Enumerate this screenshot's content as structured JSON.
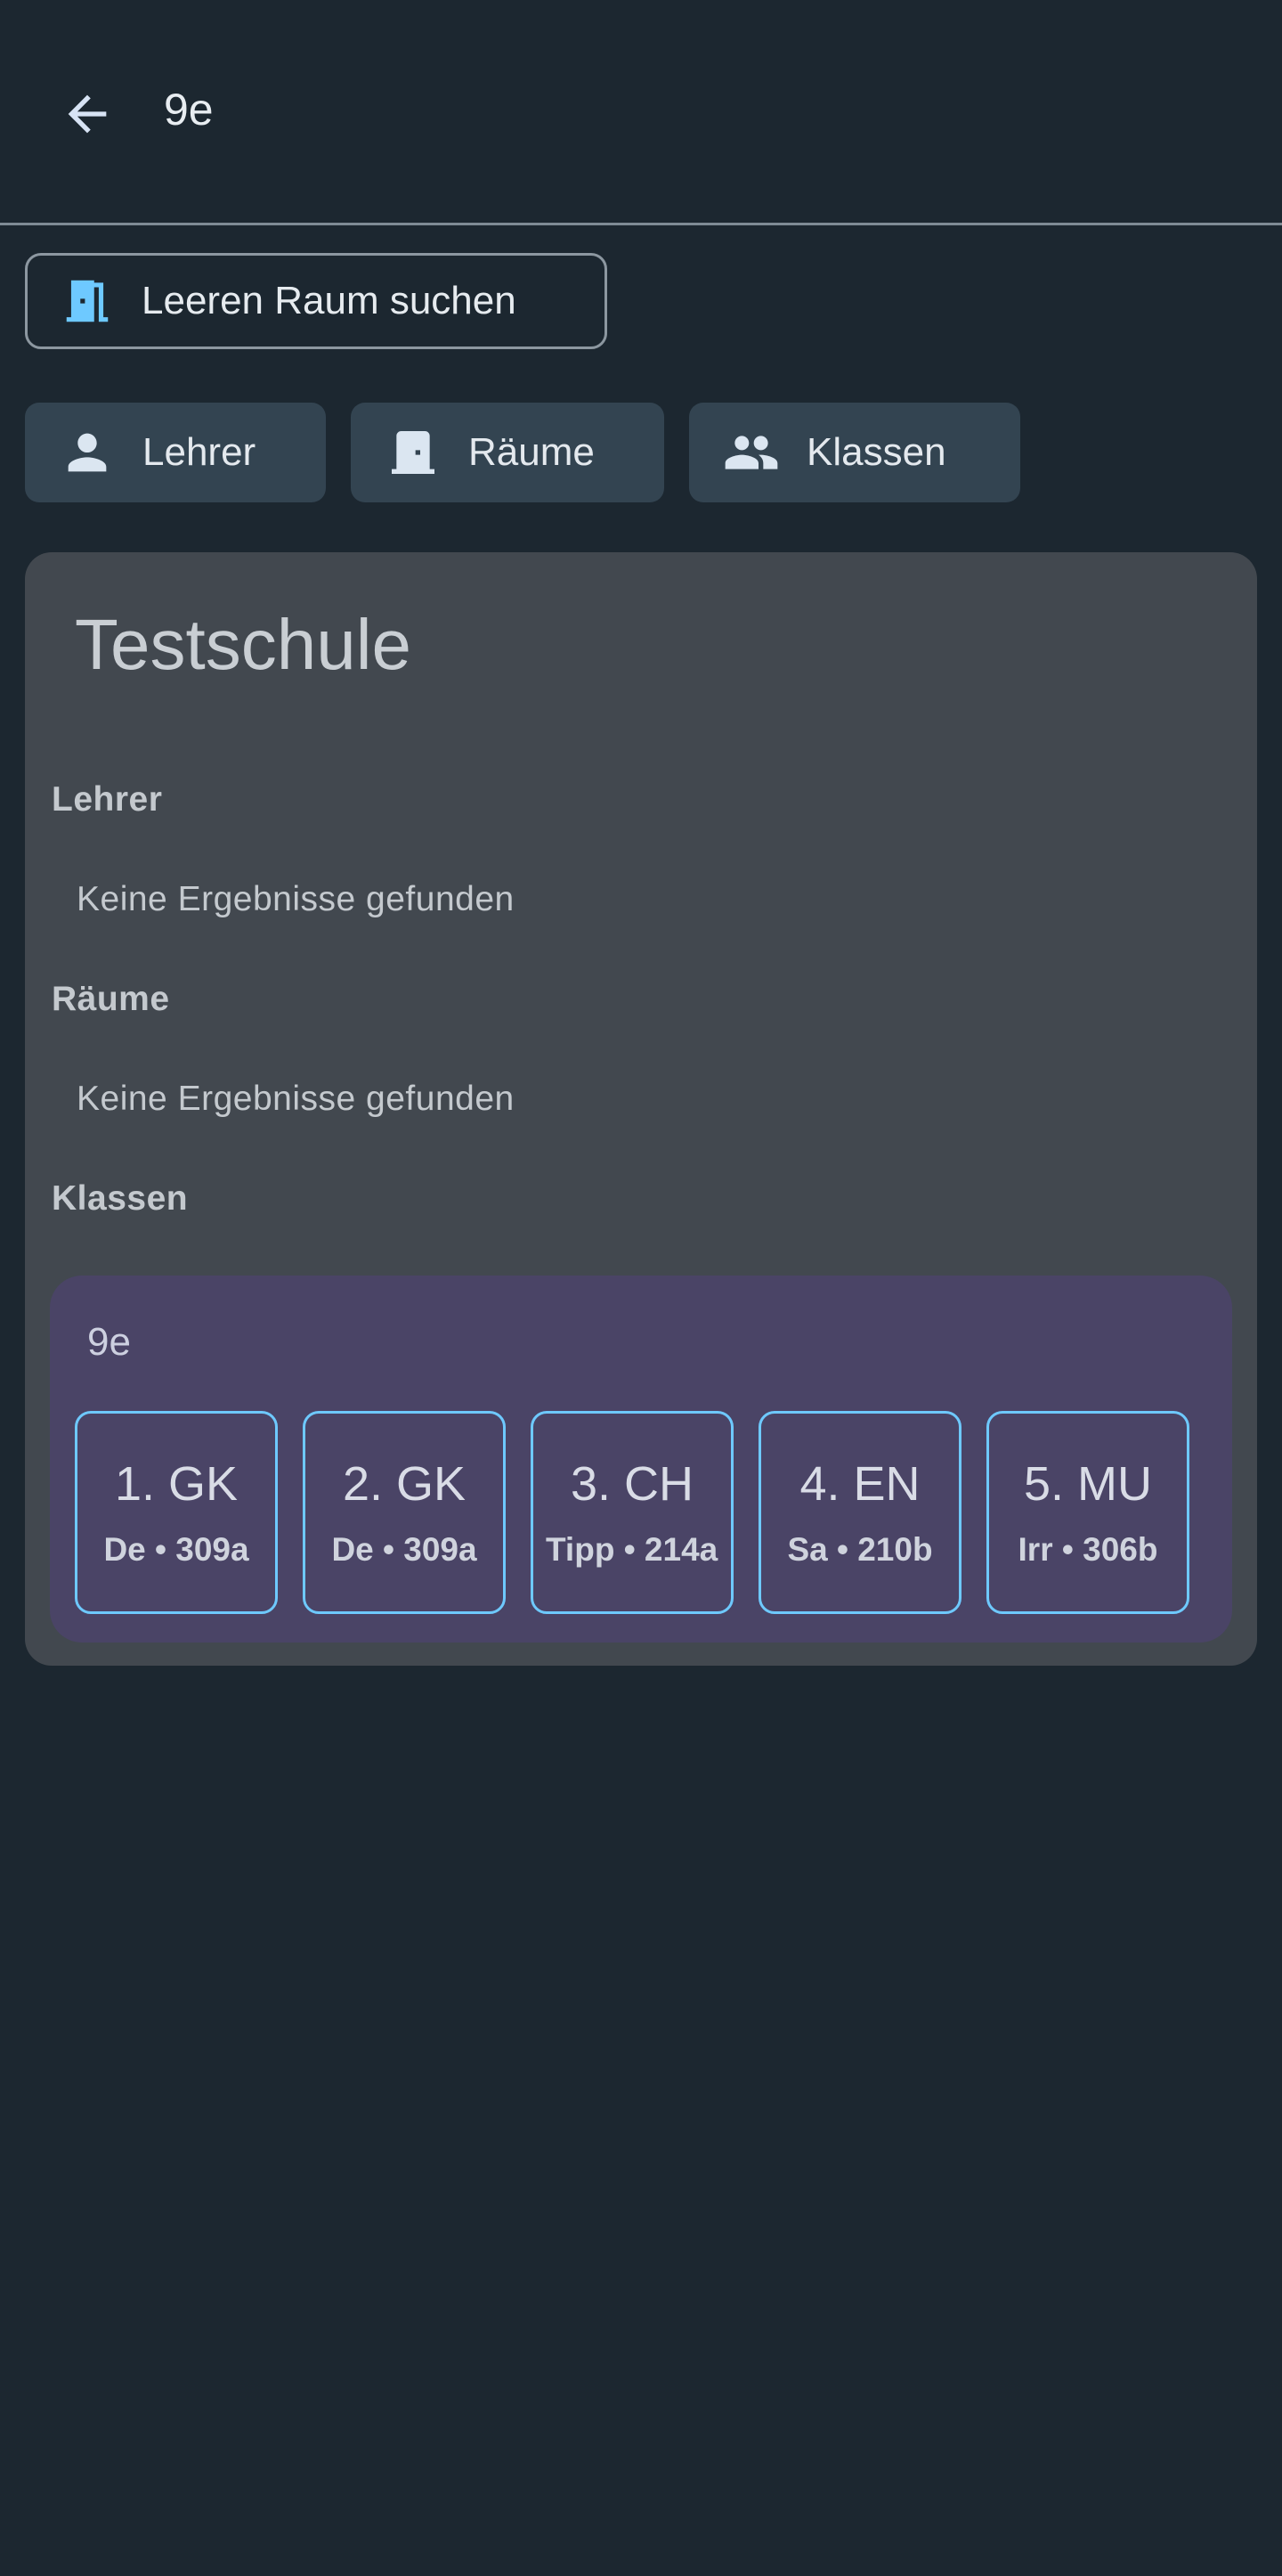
{
  "topbar": {
    "title": "9e",
    "back_icon": "arrow-left-icon"
  },
  "empty_room_button": {
    "label": "Leeren Raum suchen",
    "icon": "door-open-icon"
  },
  "filter_chips": [
    {
      "label": "Lehrer",
      "icon": "person-icon"
    },
    {
      "label": "Räume",
      "icon": "door-icon"
    },
    {
      "label": "Klassen",
      "icon": "group-icon"
    }
  ],
  "results": {
    "school_name": "Testschule",
    "sections": [
      {
        "title": "Lehrer",
        "empty_text": "Keine Ergebnisse gefunden"
      },
      {
        "title": "Räume",
        "empty_text": "Keine Ergebnisse gefunden"
      },
      {
        "title": "Klassen"
      }
    ],
    "class_card": {
      "name": "9e",
      "lessons": [
        {
          "subject": "1. GK",
          "info": "De • 309a"
        },
        {
          "subject": "2. GK",
          "info": "De • 309a"
        },
        {
          "subject": "3. CH",
          "info": "Tipp • 214a"
        },
        {
          "subject": "4. EN",
          "info": "Sa • 210b"
        },
        {
          "subject": "5. MU",
          "info": "Irr • 306b"
        }
      ]
    }
  },
  "colors": {
    "background": "#1c2730",
    "accent": "#6ec9ff",
    "chip": "#334451",
    "card": "#42484f",
    "class_card": "#4a4466"
  }
}
